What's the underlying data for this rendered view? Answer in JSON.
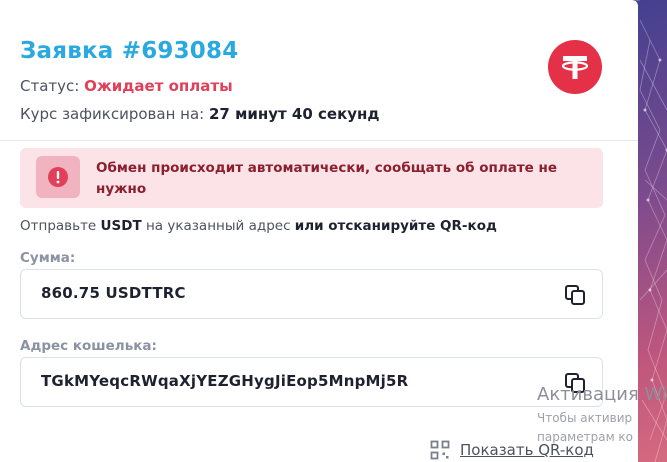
{
  "order": {
    "title": "Заявка #693084",
    "status_label": "Статус: ",
    "status_value": "Ожидает оплаты",
    "rate_label": "Курс зафиксирован на: ",
    "rate_value": "27 минут 40 секунд"
  },
  "alert": {
    "text": "Обмен происходит автоматически, сообщать об оплате не нужно"
  },
  "instruction": {
    "part1": "Отправьте ",
    "currency": "USDT",
    "part2": " на указанный адрес ",
    "part3": "или отсканируйте QR-код"
  },
  "amount": {
    "label": "Сумма:",
    "value": "860.75  USDTTRC"
  },
  "wallet": {
    "label": "Адрес кошелька:",
    "value": "TGkMYeqcRWqaXjYEZGHygJiEop5MnpMj5R"
  },
  "qr": {
    "label": "Показать QR-код"
  },
  "watermark": {
    "title": "Активация Wi",
    "line1": "Чтобы активир",
    "line2": "параметрам ко"
  },
  "colors": {
    "accent": "#2aa9e0",
    "status": "#e0405a",
    "tether": "#e53147",
    "alert_bg": "#fce3e7"
  },
  "icons": [
    "tether-logo-icon",
    "exclamation-icon",
    "copy-icon",
    "qr-code-icon"
  ]
}
